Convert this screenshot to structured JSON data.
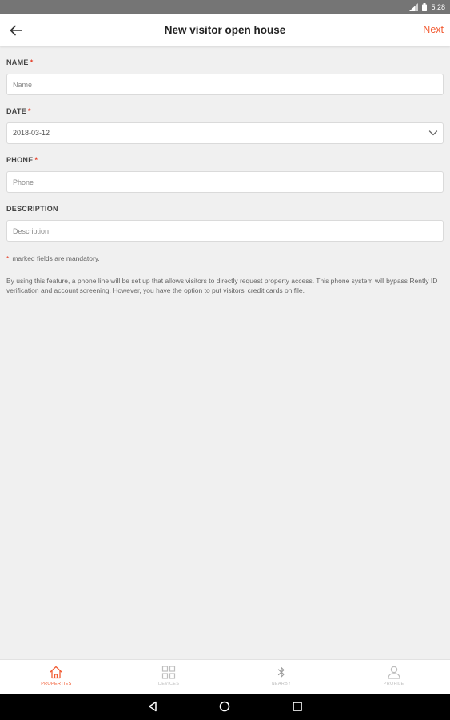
{
  "status_bar": {
    "time": "5:28"
  },
  "app_bar": {
    "title": "New visitor open house",
    "next_label": "Next"
  },
  "form": {
    "required_mark": "*",
    "name": {
      "label": "NAME",
      "placeholder": "Name",
      "required": true
    },
    "date": {
      "label": "DATE",
      "value": "2018-03-12",
      "required": true
    },
    "phone": {
      "label": "PHONE",
      "placeholder": "Phone",
      "required": true
    },
    "description": {
      "label": "DESCRIPTION",
      "placeholder": "Description",
      "required": false
    },
    "mandatory_note": "marked fields are mandatory.",
    "notice": "By using this feature, a phone line will be set up that allows visitors to directly request property access. This phone system will bypass Rently ID verification and account screening. However, you have the option to put visitors' credit cards on file."
  },
  "bottom_nav": {
    "items": [
      {
        "label": "PROPERTIES",
        "icon": "home-icon",
        "active": true
      },
      {
        "label": "DEVICES",
        "icon": "devices-icon",
        "active": false
      },
      {
        "label": "NEARBY",
        "icon": "bluetooth-icon",
        "active": false
      },
      {
        "label": "PROFILE",
        "icon": "person-icon",
        "active": false
      }
    ]
  },
  "colors": {
    "accent": "#f25c33",
    "required": "#e5412b",
    "background": "#f0f0f0"
  }
}
